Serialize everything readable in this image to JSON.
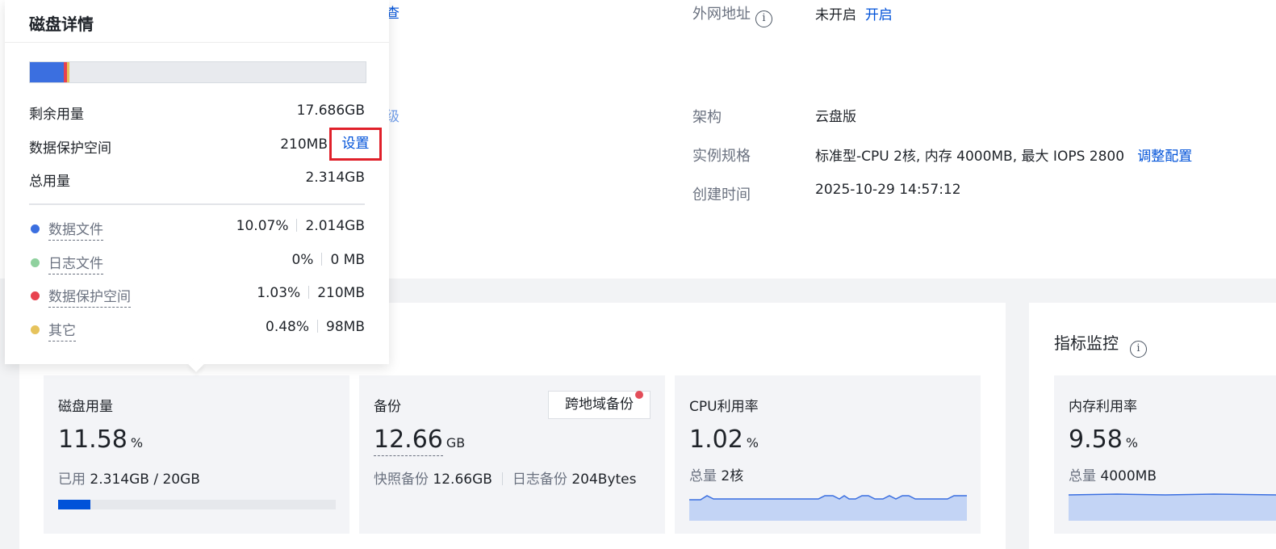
{
  "info": {
    "public_address": {
      "label": "外网地址",
      "value": "未开启",
      "action": "开启"
    },
    "architecture": {
      "label": "架构",
      "value": "云盘版"
    },
    "spec": {
      "label": "实例规格",
      "value": "标准型-CPU 2核, 内存 4000MB,  最大 IOPS 2800",
      "action": "调整配置"
    },
    "created": {
      "label": "创建时间",
      "value": "2025-10-29 14:57:12"
    },
    "edge_link_1": "查",
    "edge_link_2": "级"
  },
  "tiles": {
    "disk": {
      "title": "磁盘用量",
      "value": "11.58",
      "unit": "%",
      "used_label": "已用",
      "used_value": "2.314GB / 20GB",
      "usage_fraction": 0.1158
    },
    "backup": {
      "title": "备份",
      "value": "12.66",
      "unit": "GB",
      "button": "跨地域备份",
      "snapshot_label": "快照备份",
      "snapshot_value": "12.66GB",
      "log_label": "日志备份",
      "log_value": "204Bytes"
    },
    "cpu": {
      "title": "CPU利用率",
      "value": "1.02",
      "unit": "%",
      "total_label": "总量",
      "total_value": "2核"
    },
    "memory": {
      "title": "内存利用率",
      "value": "9.58",
      "unit": "%",
      "total_label": "总量",
      "total_value": "4000MB"
    }
  },
  "monitor": {
    "title": "指标监控"
  },
  "popup": {
    "title": "磁盘详情",
    "rows": {
      "remaining": {
        "label": "剩余用量",
        "value": "17.686GB"
      },
      "protection": {
        "label": "数据保护空间",
        "value": "210MB",
        "action": "设置"
      },
      "total": {
        "label": "总用量",
        "value": "2.314GB"
      }
    },
    "legend": [
      {
        "label": "数据文件",
        "percent": "10.07%",
        "size": "2.014GB",
        "color": "#3b6fe0"
      },
      {
        "label": "日志文件",
        "percent": "0%",
        "size": "0 MB",
        "color": "#8fd19e"
      },
      {
        "label": "数据保护空间",
        "percent": "1.03%",
        "size": "210MB",
        "color": "#e8424f"
      },
      {
        "label": "其它",
        "percent": "0.48%",
        "size": "98MB",
        "color": "#e6c35c"
      }
    ],
    "segments": [
      {
        "name": "data",
        "fraction": 0.1007,
        "color": "#3b6fe0"
      },
      {
        "name": "log",
        "fraction": 0.0,
        "color": "#8fd19e"
      },
      {
        "name": "protection",
        "fraction": 0.0103,
        "color": "#e8424f"
      },
      {
        "name": "other",
        "fraction": 0.0048,
        "color": "#e6c35c"
      }
    ]
  }
}
